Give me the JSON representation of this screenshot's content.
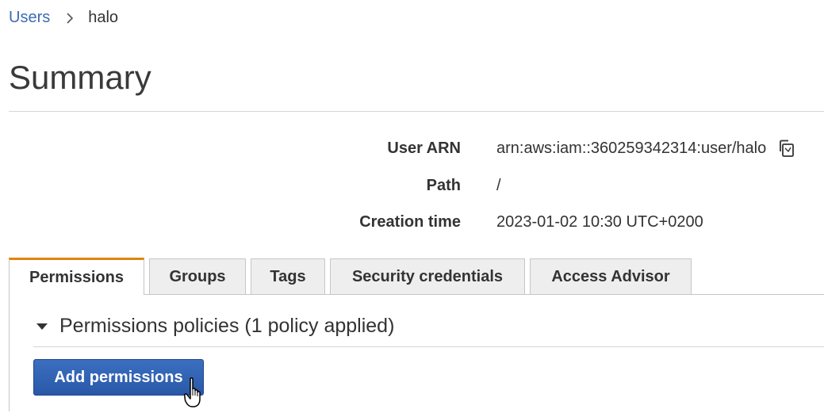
{
  "breadcrumb": {
    "parent": "Users",
    "current": "halo"
  },
  "page": {
    "title": "Summary"
  },
  "summary": {
    "rows": [
      {
        "label": "User ARN",
        "value": "arn:aws:iam::360259342314:user/halo"
      },
      {
        "label": "Path",
        "value": "/"
      },
      {
        "label": "Creation time",
        "value": "2023-01-02 10:30 UTC+0200"
      }
    ]
  },
  "tabs": [
    {
      "label": "Permissions",
      "active": true
    },
    {
      "label": "Groups",
      "active": false
    },
    {
      "label": "Tags",
      "active": false
    },
    {
      "label": "Security credentials",
      "active": false
    },
    {
      "label": "Access Advisor",
      "active": false
    }
  ],
  "permissions": {
    "section_title": "Permissions policies (1 policy applied)",
    "add_button": "Add permissions"
  },
  "colors": {
    "link": "#3d6bb3",
    "active_tab_accent": "#e0840f",
    "primary_button": "#2a58a8"
  },
  "icons": [
    "chevron-right-icon",
    "copy-icon",
    "caret-down-icon",
    "hand-pointer-cursor-icon"
  ]
}
